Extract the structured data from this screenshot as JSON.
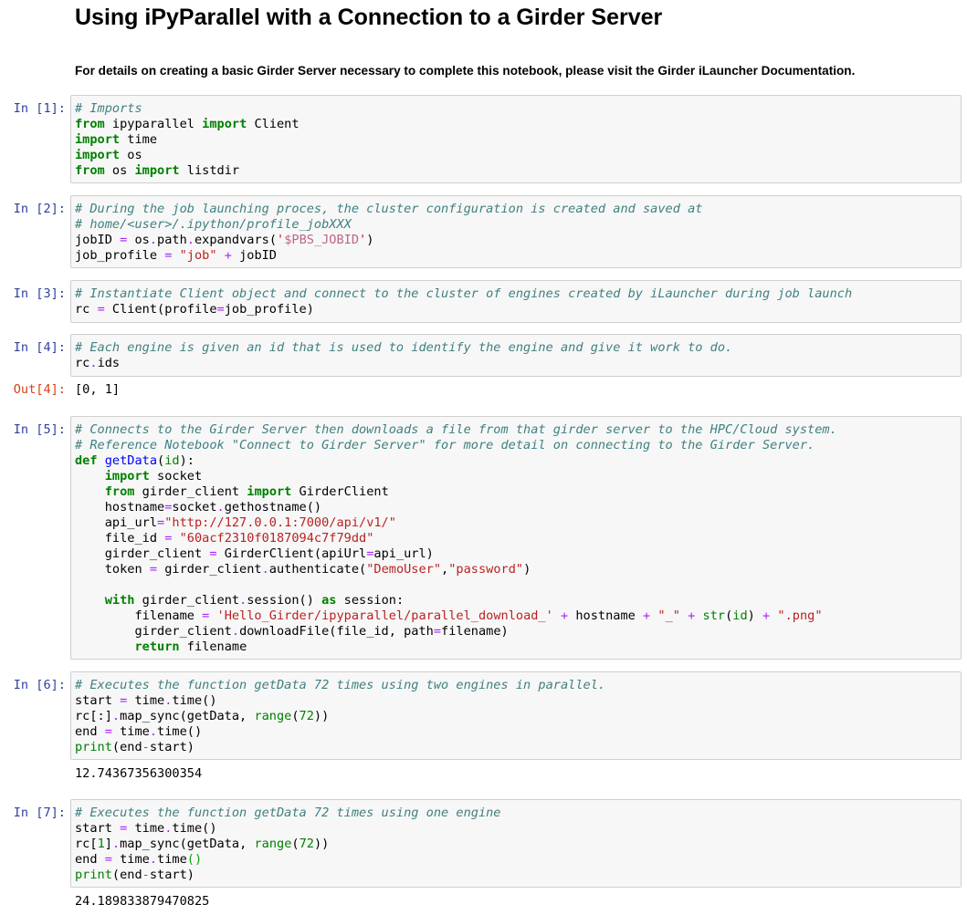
{
  "notebook": {
    "title": "Using iPyParallel with a Connection to a Girder Server",
    "intro": "For details on creating a basic Girder Server necessary to complete this notebook, please visit the Girder iLauncher Documentation."
  },
  "cells": [
    {
      "prompt": "In [1]:",
      "tokens": [
        [
          "c",
          "# Imports"
        ],
        [
          "n",
          "\n"
        ],
        [
          "k",
          "from"
        ],
        [
          "n",
          " ipyparallel "
        ],
        [
          "k",
          "import"
        ],
        [
          "n",
          " Client\n"
        ],
        [
          "k",
          "import"
        ],
        [
          "n",
          " time\n"
        ],
        [
          "k",
          "import"
        ],
        [
          "n",
          " os\n"
        ],
        [
          "k",
          "from"
        ],
        [
          "n",
          " os "
        ],
        [
          "k",
          "import"
        ],
        [
          "n",
          " listdir"
        ]
      ]
    },
    {
      "prompt": "In [2]:",
      "tokens": [
        [
          "c",
          "# During the job launching proces, the cluster configuration is created and saved at"
        ],
        [
          "n",
          "\n"
        ],
        [
          "c",
          "# home/<user>/.ipython/profile_jobXXX"
        ],
        [
          "n",
          "\n"
        ],
        [
          "n",
          "jobID "
        ],
        [
          "o",
          "="
        ],
        [
          "n",
          " os"
        ],
        [
          "o",
          "."
        ],
        [
          "n",
          "path"
        ],
        [
          "o",
          "."
        ],
        [
          "n",
          "expandvars("
        ],
        [
          "s",
          "'"
        ],
        [
          "si",
          "$PBS_JOBID"
        ],
        [
          "s",
          "'"
        ],
        [
          "n",
          ")\n"
        ],
        [
          "n",
          "job_profile "
        ],
        [
          "o",
          "="
        ],
        [
          "n",
          " "
        ],
        [
          "s",
          "\"job\""
        ],
        [
          "n",
          " "
        ],
        [
          "o",
          "+"
        ],
        [
          "n",
          " jobID"
        ]
      ]
    },
    {
      "prompt": "In [3]:",
      "tokens": [
        [
          "c",
          "# Instantiate Client object and connect to the cluster of engines created by iLauncher during job launch"
        ],
        [
          "n",
          "\n"
        ],
        [
          "n",
          "rc "
        ],
        [
          "o",
          "="
        ],
        [
          "n",
          " Client(profile"
        ],
        [
          "o",
          "="
        ],
        [
          "n",
          "job_profile)"
        ]
      ]
    },
    {
      "prompt": "In [4]:",
      "tokens": [
        [
          "c",
          "# Each engine is given an id that is used to identify the engine and give it work to do."
        ],
        [
          "n",
          "\n"
        ],
        [
          "n",
          "rc"
        ],
        [
          "o",
          "."
        ],
        [
          "n",
          "ids"
        ]
      ]
    },
    {
      "prompt": "In [5]:",
      "tokens": [
        [
          "c",
          "# Connects to the Girder Server then downloads a file from that girder server to the HPC/Cloud system."
        ],
        [
          "n",
          "\n"
        ],
        [
          "c",
          "# Reference Notebook \"Connect to Girder Server\" for more detail on connecting to the Girder Server."
        ],
        [
          "n",
          "\n"
        ],
        [
          "k",
          "def"
        ],
        [
          "n",
          " "
        ],
        [
          "nf",
          "getData"
        ],
        [
          "n",
          "("
        ],
        [
          "nb",
          "id"
        ],
        [
          "n",
          "):\n"
        ],
        [
          "n",
          "    "
        ],
        [
          "k",
          "import"
        ],
        [
          "n",
          " socket\n"
        ],
        [
          "n",
          "    "
        ],
        [
          "k",
          "from"
        ],
        [
          "n",
          " girder_client "
        ],
        [
          "k",
          "import"
        ],
        [
          "n",
          " GirderClient\n"
        ],
        [
          "n",
          "    hostname"
        ],
        [
          "o",
          "="
        ],
        [
          "n",
          "socket"
        ],
        [
          "o",
          "."
        ],
        [
          "n",
          "gethostname()\n"
        ],
        [
          "n",
          "    api_url"
        ],
        [
          "o",
          "="
        ],
        [
          "s",
          "\"http://127.0.0.1:7000/api/v1/\""
        ],
        [
          "n",
          "\n"
        ],
        [
          "n",
          "    file_id "
        ],
        [
          "o",
          "="
        ],
        [
          "n",
          " "
        ],
        [
          "s",
          "\"60acf2310f0187094c7f79dd\""
        ],
        [
          "n",
          "\n"
        ],
        [
          "n",
          "    girder_client "
        ],
        [
          "o",
          "="
        ],
        [
          "n",
          " GirderClient(apiUrl"
        ],
        [
          "o",
          "="
        ],
        [
          "n",
          "api_url)\n"
        ],
        [
          "n",
          "    token "
        ],
        [
          "o",
          "="
        ],
        [
          "n",
          " girder_client"
        ],
        [
          "o",
          "."
        ],
        [
          "n",
          "authenticate("
        ],
        [
          "s",
          "\"DemoUser\""
        ],
        [
          "n",
          ","
        ],
        [
          "s",
          "\"password\""
        ],
        [
          "n",
          ")\n"
        ],
        [
          "n",
          "\n"
        ],
        [
          "n",
          "    "
        ],
        [
          "k",
          "with"
        ],
        [
          "n",
          " girder_client"
        ],
        [
          "o",
          "."
        ],
        [
          "n",
          "session() "
        ],
        [
          "k",
          "as"
        ],
        [
          "n",
          " session:\n"
        ],
        [
          "n",
          "        filename "
        ],
        [
          "o",
          "="
        ],
        [
          "n",
          " "
        ],
        [
          "s",
          "'Hello_Girder/ipyparallel/parallel_download_'"
        ],
        [
          "n",
          " "
        ],
        [
          "o",
          "+"
        ],
        [
          "n",
          " hostname "
        ],
        [
          "o",
          "+"
        ],
        [
          "n",
          " "
        ],
        [
          "s",
          "\"_\""
        ],
        [
          "n",
          " "
        ],
        [
          "o",
          "+"
        ],
        [
          "n",
          " "
        ],
        [
          "nb",
          "str"
        ],
        [
          "n",
          "("
        ],
        [
          "nb",
          "id"
        ],
        [
          "n",
          ") "
        ],
        [
          "o",
          "+"
        ],
        [
          "n",
          " "
        ],
        [
          "s",
          "\".png\""
        ],
        [
          "n",
          "\n"
        ],
        [
          "n",
          "        girder_client"
        ],
        [
          "o",
          "."
        ],
        [
          "n",
          "downloadFile(file_id, path"
        ],
        [
          "o",
          "="
        ],
        [
          "n",
          "filename)\n"
        ],
        [
          "n",
          "        "
        ],
        [
          "k",
          "return"
        ],
        [
          "n",
          " filename"
        ]
      ]
    },
    {
      "prompt": "In [6]:",
      "tokens": [
        [
          "c",
          "# Executes the function getData 72 times using two engines in parallel."
        ],
        [
          "n",
          "\n"
        ],
        [
          "n",
          "start "
        ],
        [
          "o",
          "="
        ],
        [
          "n",
          " time"
        ],
        [
          "o",
          "."
        ],
        [
          "n",
          "time()\n"
        ],
        [
          "n",
          "rc[:]"
        ],
        [
          "o",
          "."
        ],
        [
          "n",
          "map_sync(getData, "
        ],
        [
          "nb",
          "range"
        ],
        [
          "n",
          "("
        ],
        [
          "m",
          "72"
        ],
        [
          "n",
          "))\n"
        ],
        [
          "n",
          "end "
        ],
        [
          "o",
          "="
        ],
        [
          "n",
          " time"
        ],
        [
          "o",
          "."
        ],
        [
          "n",
          "time()\n"
        ],
        [
          "nb",
          "print"
        ],
        [
          "n",
          "(end"
        ],
        [
          "o",
          "-"
        ],
        [
          "n",
          "start)"
        ]
      ]
    },
    {
      "prompt": "In [7]:",
      "tokens": [
        [
          "c",
          "# Executes the function getData 72 times using one engine"
        ],
        [
          "n",
          "\n"
        ],
        [
          "n",
          "start "
        ],
        [
          "o",
          "="
        ],
        [
          "n",
          " time"
        ],
        [
          "o",
          "."
        ],
        [
          "n",
          "time()\n"
        ],
        [
          "n",
          "rc["
        ],
        [
          "m",
          "1"
        ],
        [
          "n",
          "]"
        ],
        [
          "o",
          "."
        ],
        [
          "n",
          "map_sync(getData, "
        ],
        [
          "nb",
          "range"
        ],
        [
          "n",
          "("
        ],
        [
          "m",
          "72"
        ],
        [
          "n",
          "))\n"
        ],
        [
          "n",
          "end "
        ],
        [
          "o",
          "="
        ],
        [
          "n",
          " time"
        ],
        [
          "o",
          "."
        ],
        [
          "n",
          "time"
        ],
        [
          "pg",
          "()"
        ],
        [
          "n",
          "\n"
        ],
        [
          "nb",
          "print"
        ],
        [
          "n",
          "(end"
        ],
        [
          "o",
          "-"
        ],
        [
          "n",
          "start)"
        ]
      ]
    }
  ],
  "outputs": [
    {
      "prompt": "Out[4]:",
      "text": "[0, 1]"
    },
    {
      "prompt": "",
      "text": "12.74367356300354"
    },
    {
      "prompt": "",
      "text": "24.189833879470825"
    }
  ]
}
